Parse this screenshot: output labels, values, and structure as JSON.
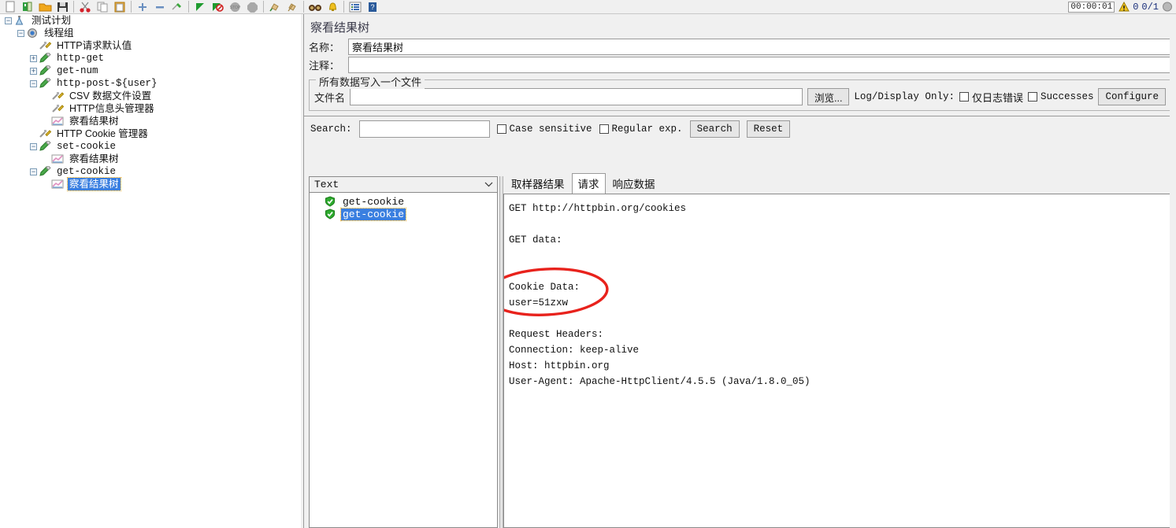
{
  "toolbar": {
    "icons": [
      {
        "name": "new-test-plan-icon",
        "glyph": "new"
      },
      {
        "name": "templates-icon",
        "glyph": "templates"
      },
      {
        "name": "open-icon",
        "glyph": "folder"
      },
      {
        "name": "save-icon",
        "glyph": "floppy"
      },
      {
        "name": "cut-icon",
        "glyph": "scissors"
      },
      {
        "name": "copy-icon",
        "glyph": "copy"
      },
      {
        "name": "paste-icon",
        "glyph": "paste"
      },
      {
        "name": "expand-all-icon",
        "glyph": "plus"
      },
      {
        "name": "collapse-all-icon",
        "glyph": "minus"
      },
      {
        "name": "toggle-icon",
        "glyph": "toggle"
      },
      {
        "name": "start-icon",
        "glyph": "play"
      },
      {
        "name": "start-no-pauses-icon",
        "glyph": "play-no-timers"
      },
      {
        "name": "stop-icon",
        "glyph": "stop"
      },
      {
        "name": "shutdown-icon",
        "glyph": "shutdown"
      },
      {
        "name": "clear-icon",
        "glyph": "broom"
      },
      {
        "name": "clear-all-icon",
        "glyph": "broom2"
      },
      {
        "name": "search-icon",
        "glyph": "binoculars"
      },
      {
        "name": "reset-search-icon",
        "glyph": "bell"
      },
      {
        "name": "function-helper-icon",
        "glyph": "functions"
      },
      {
        "name": "help-icon",
        "glyph": "help"
      }
    ],
    "timer": "00:00:01",
    "warnings": "0",
    "thread_counts": "0/1"
  },
  "tree": {
    "nodes": [
      {
        "label": "测试计划",
        "indent": 0,
        "toggle": "minus",
        "icon": "test-plan-icon",
        "cn": true,
        "selected": false
      },
      {
        "label": "线程组",
        "indent": 1,
        "toggle": "minus",
        "icon": "thread-group-icon",
        "cn": true,
        "selected": false
      },
      {
        "label": "HTTP请求默认值",
        "indent": 2,
        "toggle": "none",
        "icon": "config-element-icon",
        "cn": true,
        "selected": false
      },
      {
        "label": "http-get",
        "indent": 2,
        "toggle": "plus",
        "icon": "http-sampler-icon",
        "cn": false,
        "selected": false
      },
      {
        "label": "get-num",
        "indent": 2,
        "toggle": "plus",
        "icon": "http-sampler-icon",
        "cn": false,
        "selected": false
      },
      {
        "label": "http-post-${user}",
        "indent": 2,
        "toggle": "minus",
        "icon": "http-sampler-icon",
        "cn": false,
        "selected": false
      },
      {
        "label": "CSV 数据文件设置",
        "indent": 3,
        "toggle": "none",
        "icon": "config-element-icon",
        "cn": true,
        "selected": false
      },
      {
        "label": "HTTP信息头管理器",
        "indent": 3,
        "toggle": "none",
        "icon": "config-element-icon",
        "cn": true,
        "selected": false
      },
      {
        "label": "察看结果树",
        "indent": 3,
        "toggle": "none",
        "icon": "listener-icon",
        "cn": true,
        "selected": false
      },
      {
        "label": "HTTP Cookie 管理器",
        "indent": 2,
        "toggle": "none",
        "icon": "config-element-icon",
        "cn": true,
        "selected": false
      },
      {
        "label": "set-cookie",
        "indent": 2,
        "toggle": "minus",
        "icon": "http-sampler-icon",
        "cn": false,
        "selected": false
      },
      {
        "label": "察看结果树",
        "indent": 3,
        "toggle": "none",
        "icon": "listener-icon",
        "cn": true,
        "selected": false
      },
      {
        "label": "get-cookie",
        "indent": 2,
        "toggle": "minus",
        "icon": "http-sampler-icon",
        "cn": false,
        "selected": false
      },
      {
        "label": "察看结果树",
        "indent": 3,
        "toggle": "none",
        "icon": "listener-icon",
        "cn": true,
        "selected": true
      }
    ]
  },
  "panel": {
    "title": "察看结果树",
    "name_label": "名称：",
    "name_value": "察看结果树",
    "comment_label": "注释：",
    "comment_value": "",
    "file_group_title": "所有数据写入一个文件",
    "filename_label": "文件名",
    "filename_value": "",
    "browse_button": "浏览...",
    "log_display_only_label": "Log/Display Only:",
    "errors_only_label": "仅日志错误",
    "successes_label": "Successes",
    "configure_button": "Configure"
  },
  "search": {
    "label": "Search:",
    "value": "",
    "case_sensitive_label": "Case sensitive",
    "regular_exp_label": "Regular exp.",
    "search_button": "Search",
    "reset_button": "Reset"
  },
  "results": {
    "render_combo_value": "Text",
    "items": [
      {
        "label": "get-cookie",
        "status": "success",
        "selected": false
      },
      {
        "label": "get-cookie",
        "status": "success",
        "selected": true
      }
    ]
  },
  "tabs": [
    {
      "label": "取样器结果",
      "active": false
    },
    {
      "label": "请求",
      "active": true
    },
    {
      "label": "响应数据",
      "active": false
    }
  ],
  "request_text": {
    "lines": [
      "GET http://httpbin.org/cookies",
      "",
      "GET data:",
      "",
      "",
      "Cookie Data:",
      "user=51zxw",
      "",
      "Request Headers:",
      "Connection: keep-alive",
      "Host: httpbin.org",
      "User-Agent: Apache-HttpClient/4.5.5 (Java/1.8.0_05)"
    ]
  },
  "annotation": {
    "shape": "red-ellipse",
    "color": "#e8221c",
    "targets": "Cookie Data: user=51zxw"
  },
  "colors": {
    "selection_blue": "#3a7fe0",
    "panel_bg": "#f0f0f0",
    "success_green": "#2eaa2e",
    "annotation_red": "#e8221c"
  }
}
